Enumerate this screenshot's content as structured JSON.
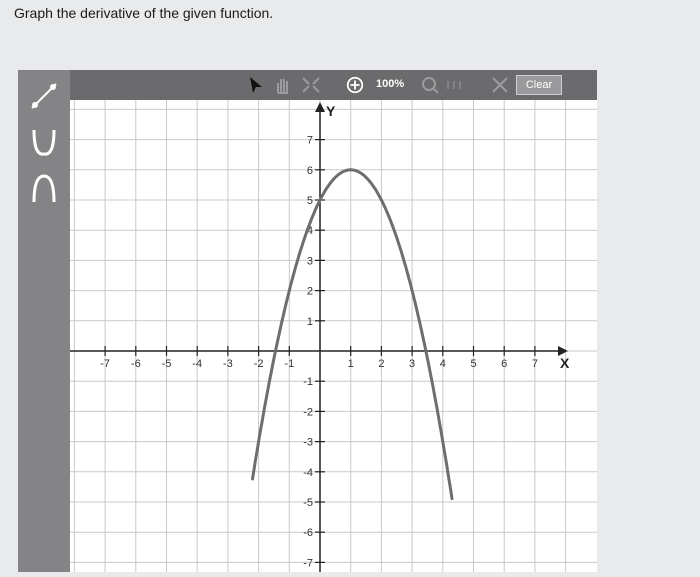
{
  "question": "Graph the derivative of the given function.",
  "tools": [
    {
      "name": "line-tool",
      "icon": "line-segment-icon"
    },
    {
      "name": "parabola-up-tool",
      "icon": "parabola-up-icon"
    },
    {
      "name": "parabola-down-tool",
      "icon": "parabola-down-icon"
    }
  ],
  "toolbar": {
    "zoom": "100%",
    "clear_label": "Clear",
    "icons": [
      "pointer-icon",
      "hand-icon",
      "fit-icon",
      "zoom-in-icon",
      "zoom-out-icon",
      "zoom-reset-icon",
      "delete-icon"
    ]
  },
  "chart_data": {
    "type": "line",
    "xlabel": "X",
    "ylabel": "Y",
    "xlim": [
      -8,
      8
    ],
    "ylim": [
      -7,
      8
    ],
    "x_ticks": [
      -7,
      -6,
      -5,
      -4,
      -3,
      -2,
      -1,
      1,
      2,
      3,
      4,
      5,
      6,
      7
    ],
    "y_ticks": [
      -7,
      -6,
      -5,
      -4,
      -3,
      -2,
      -1,
      1,
      2,
      3,
      4,
      5,
      6,
      7
    ],
    "grid": true,
    "series": [
      {
        "function": "parabola",
        "equation": "y = -(x - 1)^2 + 6",
        "vertex": [
          1,
          6
        ],
        "x_intercepts": [
          -1.45,
          3.45
        ],
        "y_intercept": 5,
        "color": "#6e6e6e"
      }
    ]
  },
  "colors": {
    "curve": "#6e6e6e",
    "grid": "#c9c9c9",
    "axis": "#222222",
    "toolbar": "#6b6b6d",
    "rail": "#848486"
  }
}
